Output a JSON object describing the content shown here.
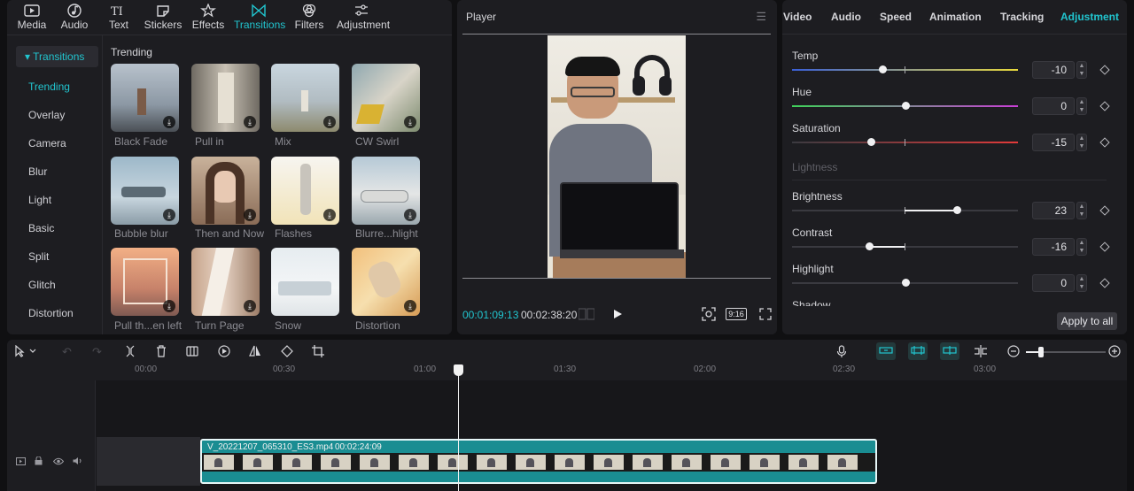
{
  "toolbar": {
    "items": [
      {
        "label": "Media"
      },
      {
        "label": "Audio"
      },
      {
        "label": "Text"
      },
      {
        "label": "Stickers"
      },
      {
        "label": "Effects"
      },
      {
        "label": "Transitions"
      },
      {
        "label": "Filters"
      },
      {
        "label": "Adjustment"
      }
    ],
    "active": "Transitions"
  },
  "categories": {
    "header": "Transitions",
    "items": [
      "Trending",
      "Overlay",
      "Camera",
      "Blur",
      "Light",
      "Basic",
      "Split",
      "Glitch",
      "Distortion"
    ],
    "active": "Trending"
  },
  "grid": {
    "title": "Trending",
    "items": [
      {
        "label": "Black Fade"
      },
      {
        "label": "Pull in"
      },
      {
        "label": "Mix"
      },
      {
        "label": "CW Swirl"
      },
      {
        "label": "Bubble blur"
      },
      {
        "label": "Then and Now"
      },
      {
        "label": "Flashes"
      },
      {
        "label": "Blurre...hlight"
      },
      {
        "label": "Pull th...en left"
      },
      {
        "label": "Turn Page"
      },
      {
        "label": "Snow"
      },
      {
        "label": "Distortion"
      }
    ]
  },
  "player": {
    "title": "Player",
    "current_time": "00:01:09:13",
    "total_time": "00:02:38:20",
    "ratio": "9:16"
  },
  "right_panel": {
    "tabs": [
      "Video",
      "Audio",
      "Speed",
      "Animation",
      "Tracking",
      "Adjustment"
    ],
    "active_tab": "Adjustment",
    "section_lightness": "Lightness",
    "sliders": [
      {
        "label": "Temp",
        "value": "-10",
        "pct": 0.4
      },
      {
        "label": "Hue",
        "value": "0",
        "pct": 0.5
      },
      {
        "label": "Saturation",
        "value": "-15",
        "pct": 0.35
      },
      {
        "label": "Brightness",
        "value": "23",
        "pct": 0.73
      },
      {
        "label": "Contrast",
        "value": "-16",
        "pct": 0.34
      },
      {
        "label": "Highlight",
        "value": "0",
        "pct": 0.5
      },
      {
        "label": "Shadow"
      }
    ],
    "apply_label": "Apply to all"
  },
  "timeline": {
    "ruler": [
      "00:00",
      "00:30",
      "01:00",
      "01:30",
      "02:00",
      "02:30",
      "03:00"
    ],
    "clip_name": "V_20221207_065310_ES3.mp4",
    "clip_duration": "00:02:24:09"
  }
}
